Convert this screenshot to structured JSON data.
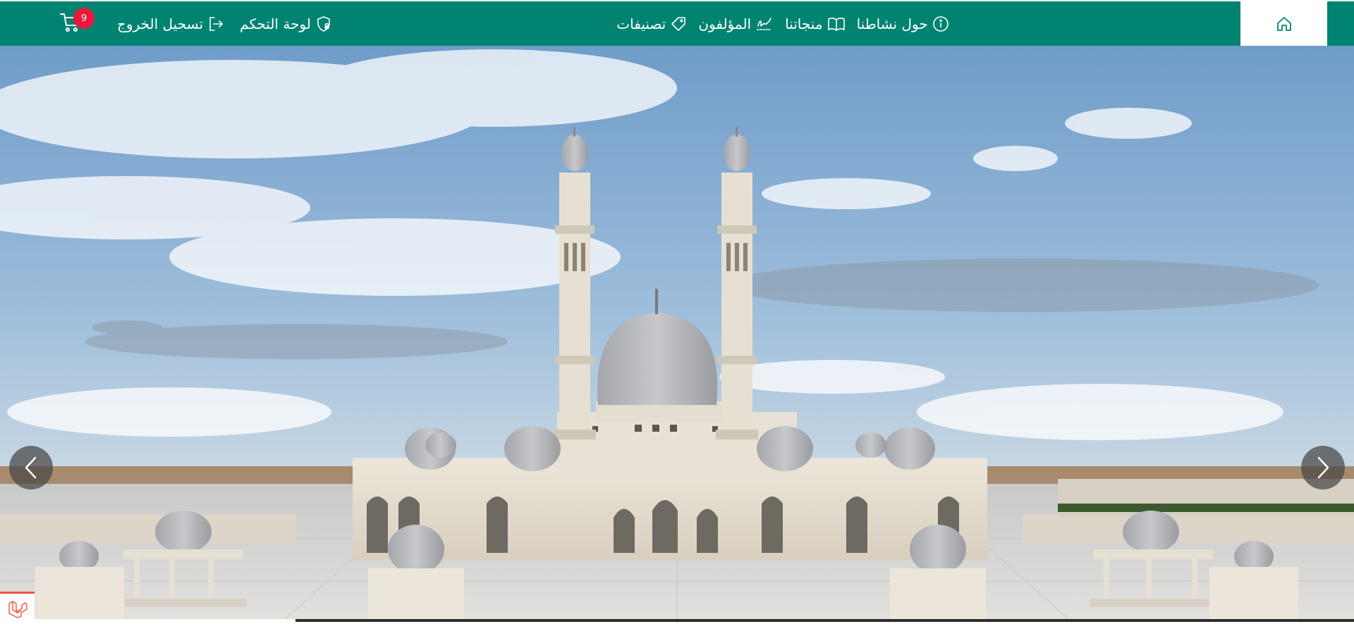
{
  "nav": {
    "links": [
      {
        "label": "حول نشاطنا",
        "icon": "info-icon"
      },
      {
        "label": "منجاتنا",
        "icon": "book-icon"
      },
      {
        "label": "المؤلفون",
        "icon": "signature-icon"
      },
      {
        "label": "تصنيفات",
        "icon": "tag-icon"
      }
    ],
    "dashboard_label": "لوحة التحكم",
    "logout_label": "تسحيل الخروج",
    "cart_count": "9",
    "home_icon": "home-icon"
  },
  "hero": {
    "image": "mosque-illustration",
    "prev_icon": "chevron-left-icon",
    "next_icon": "chevron-right-icon"
  },
  "colors": {
    "nav_bg": "#018372",
    "badge": "#e8193c",
    "laravel": "#f05340"
  }
}
